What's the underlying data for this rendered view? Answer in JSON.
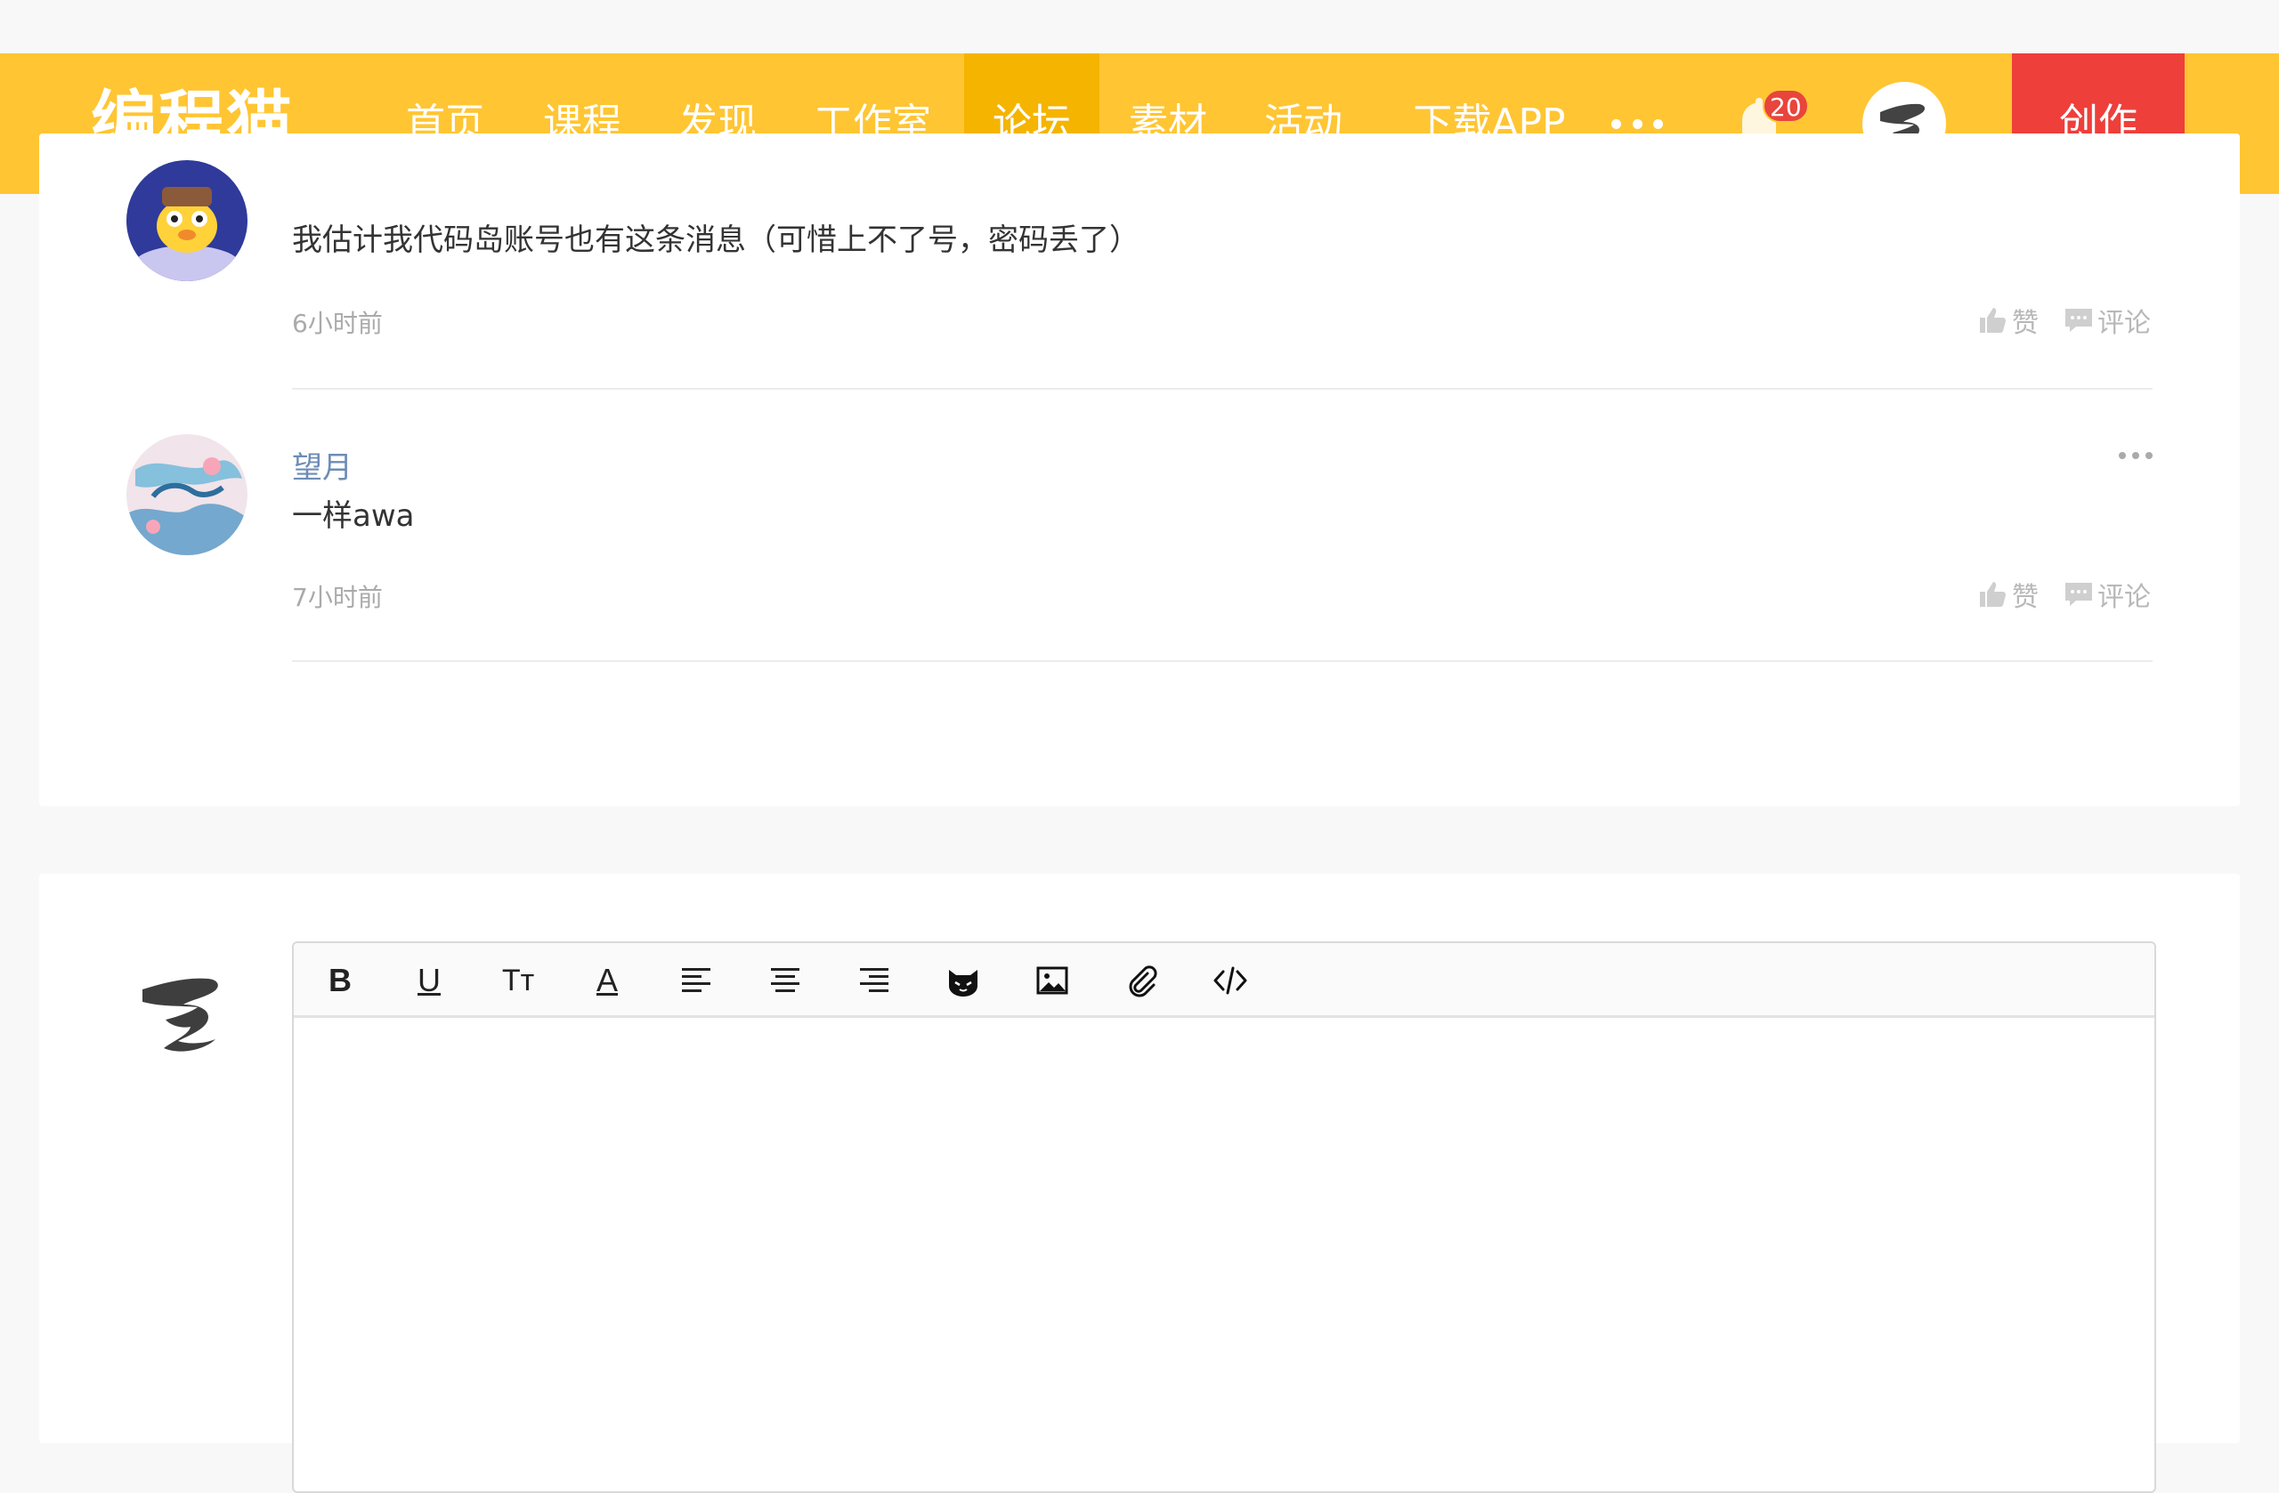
{
  "nav": {
    "logo": "编程猫",
    "items": [
      {
        "label": "首页"
      },
      {
        "label": "课程"
      },
      {
        "label": "发现"
      },
      {
        "label": "工作室"
      },
      {
        "label": "论坛"
      },
      {
        "label": "素材"
      },
      {
        "label": "活动"
      },
      {
        "label": "下载APP"
      }
    ],
    "active_item": "论坛",
    "notification_count": "20",
    "create_label": "创作",
    "colors": {
      "bar": "#ffc533",
      "active": "#f4b400",
      "create": "#ee3f3b"
    }
  },
  "comments": [
    {
      "author": "",
      "text": "我估计我代码岛账号也有这条消息（可惜上不了号，密码丢了）",
      "time": "6小时前",
      "like_label": "赞",
      "comment_label": "评论"
    },
    {
      "author": "望月",
      "text": "一样awa",
      "time": "7小时前",
      "like_label": "赞",
      "comment_label": "评论"
    }
  ],
  "editor": {
    "toolbar": [
      {
        "icon": "bold-icon",
        "glyph": "B"
      },
      {
        "icon": "underline-icon",
        "glyph": "U"
      },
      {
        "icon": "font-size-icon",
        "glyph": "Tт"
      },
      {
        "icon": "font-color-icon",
        "glyph": "A"
      },
      {
        "icon": "align-left-icon"
      },
      {
        "icon": "align-center-icon"
      },
      {
        "icon": "align-right-icon"
      },
      {
        "icon": "emoji-cat-icon"
      },
      {
        "icon": "image-icon"
      },
      {
        "icon": "attachment-icon"
      },
      {
        "icon": "code-icon"
      }
    ],
    "content": ""
  }
}
